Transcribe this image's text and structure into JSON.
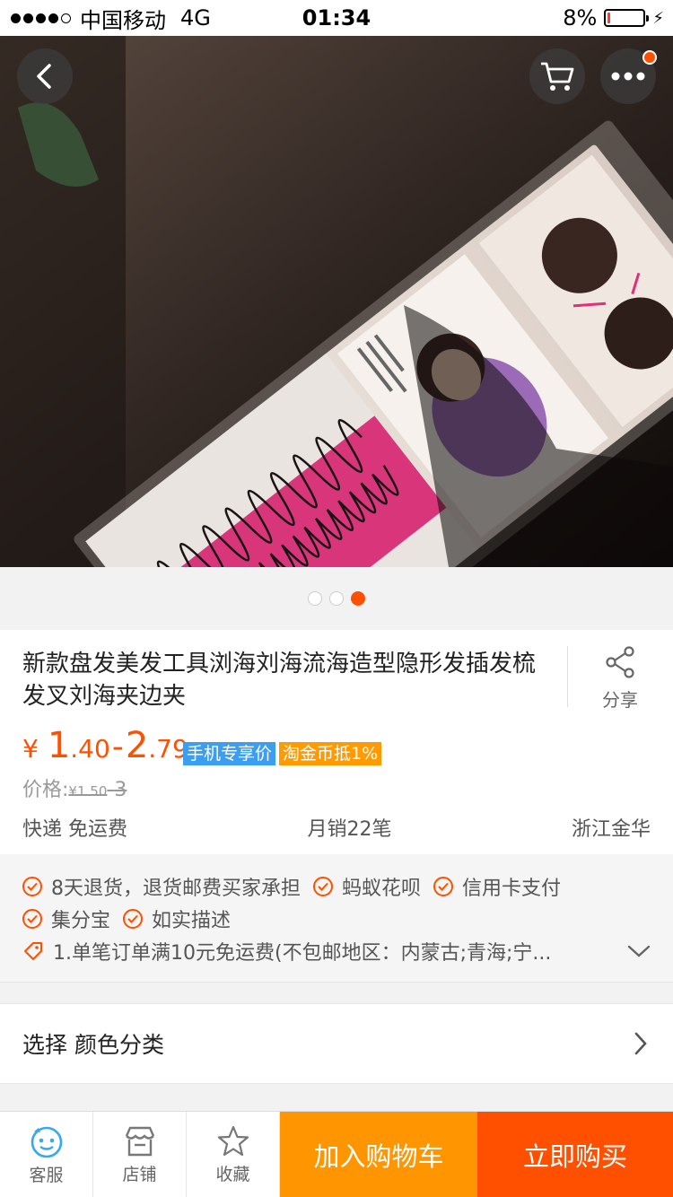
{
  "status_bar": {
    "carrier": "中国移动",
    "network": "4G",
    "time": "01:34",
    "battery_percent": "8%",
    "battery_level": 0.08
  },
  "gallery": {
    "page_count": 3,
    "active_page": 3
  },
  "product": {
    "title": "新款盘发美发工具浏海刘海流海造型隐形发插发梳发叉刘海夹边夹",
    "share_label": "分享",
    "currency": "¥",
    "price_low_int": "1",
    "price_low_dec": ".40",
    "price_sep": "-",
    "price_high_int": "2",
    "price_high_dec": ".79",
    "tag_mobile": "手机专享价",
    "tag_coin": "淘金币抵1%",
    "orig_label": "价格:",
    "orig_currency": "¥",
    "orig_low": "1.50",
    "orig_sep": "-",
    "orig_high": "3",
    "shipping": "快递 免运费",
    "monthly_sales": "月销22笔",
    "location": "浙江金华"
  },
  "services": {
    "row1": [
      "8天退货，退货邮费买家承担",
      "蚂蚁花呗",
      "信用卡支付"
    ],
    "row2": [
      "集分宝",
      "如实描述"
    ],
    "promo": "1.单笔订单满10元免运费(不包邮地区：内蒙古;青海;宁..."
  },
  "spec": {
    "label": "选择 颜色分类"
  },
  "bottom_bar": {
    "service": "客服",
    "shop": "店铺",
    "favorite": "收藏",
    "add_cart": "加入购物车",
    "buy_now": "立即购买"
  },
  "colors": {
    "accent": "#ff5000",
    "cart_button": "#ff9500",
    "tag_blue": "#3b9ef0",
    "tag_orange": "#ff9a00"
  },
  "icons": [
    "back-arrow-icon",
    "cart-icon",
    "more-icon",
    "share-icon",
    "check-circle-icon",
    "coupon-icon",
    "chevron-down-icon",
    "chevron-right-icon",
    "service-face-icon",
    "shop-icon",
    "star-icon"
  ]
}
